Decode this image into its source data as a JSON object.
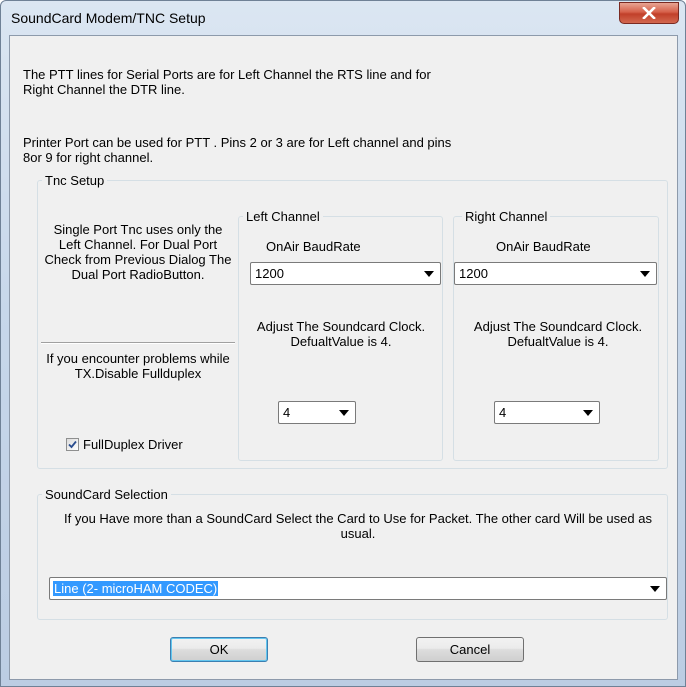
{
  "window": {
    "title": "SoundCard Modem/TNC Setup"
  },
  "info": {
    "ptt_line1": "The PTT lines for Serial Ports are for Left Channel the RTS line and for",
    "ptt_line2": "Right Channel the DTR line.",
    "printer_line1": "Printer Port can be used for PTT . Pins 2 or 3 are for Left channel and pins",
    "printer_line2": "8or 9 for right channel."
  },
  "tnc_setup": {
    "legend": "Tnc Setup",
    "single_port_text": "Single Port Tnc uses only the Left Channel. For Dual Port Check from Previous Dialog The Dual Port RadioButton.",
    "problems_text": "If you encounter problems while TX.Disable Fullduplex",
    "fullduplex_label": "FullDuplex Driver",
    "fullduplex_checked": true
  },
  "left_channel": {
    "legend": "Left Channel",
    "baud_label": "OnAir BaudRate",
    "baud_value": "1200",
    "adjust_text": "Adjust The Soundcard Clock. DefualtValue is 4.",
    "clock_value": "4"
  },
  "right_channel": {
    "legend": "Right Channel",
    "baud_label": "OnAir BaudRate",
    "baud_value": "1200",
    "adjust_text": "Adjust The Soundcard Clock. DefualtValue is 4.",
    "clock_value": "4"
  },
  "soundcard_selection": {
    "legend": "SoundCard Selection",
    "description": "If you Have more than a SoundCard Select the Card to Use for Packet. The other card Will be used as usual.",
    "selected_card": "Line (2- microHAM CODEC)"
  },
  "buttons": {
    "ok": "OK",
    "cancel": "Cancel"
  }
}
